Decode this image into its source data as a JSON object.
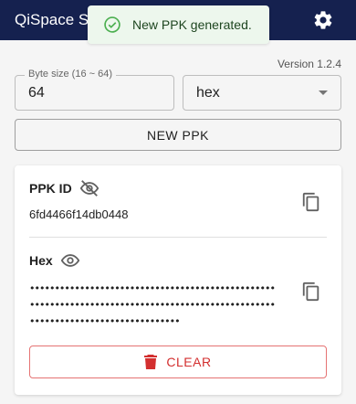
{
  "appbar": {
    "title": "QiSpace Studio"
  },
  "toast": {
    "message": "New PPK generated."
  },
  "version": "Version 1.2.4",
  "form": {
    "byte_size_label": "Byte size (16 ~ 64)",
    "byte_size_value": "64",
    "format_value": "hex"
  },
  "buttons": {
    "new_ppk": "NEW PPK",
    "clear": "CLEAR"
  },
  "card": {
    "ppk_id_label": "PPK ID",
    "ppk_id_value": "6fd4466f14db0448",
    "hex_label": "Hex",
    "hex_masked": "••••••••••••••••••••••••••••••••••••••••••••••••••••••••••••••••••••••••••••••••••••••••••••••••••••••••••••••••••••••••••••••••"
  },
  "colors": {
    "appbar": "#15214f",
    "toast_bg": "#edf7ed",
    "toast_icon": "#4caf50",
    "danger": "#d32f2f"
  },
  "icons": {
    "settings": "gear-icon",
    "toast": "check-circle-icon",
    "ppk_visibility": "eye-off-icon",
    "hex_visibility": "eye-icon",
    "copy": "copy-icon",
    "clear": "trash-icon"
  }
}
